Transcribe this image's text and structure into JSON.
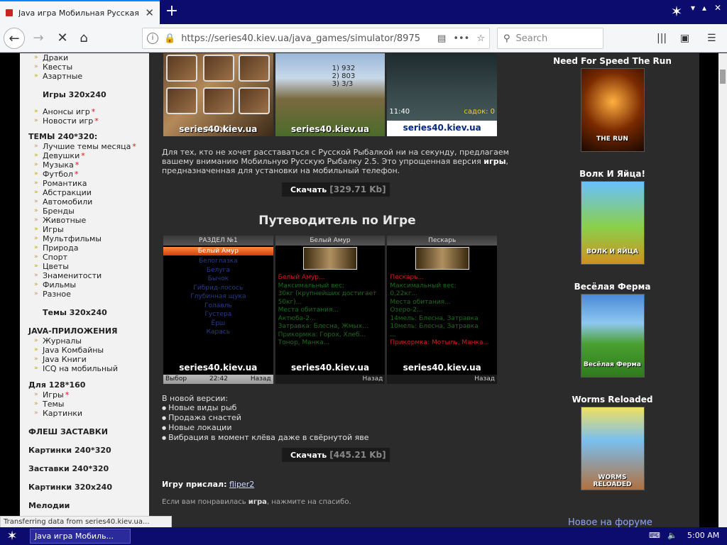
{
  "browser": {
    "tab_title": "Java игра Мобильная Русская Ры",
    "url": "https://series40.kiev.ua/java_games/simulator/8975",
    "search_placeholder": "Search"
  },
  "sidebar": {
    "top_items": [
      "Драки",
      "Квесты",
      "Азартные"
    ],
    "games_320": "Игры 320x240",
    "announce_items": [
      {
        "label": "Анонсы игр",
        "star": "*"
      },
      {
        "label": "Новости игр",
        "star": "*"
      }
    ],
    "themes_240_title": "ТЕМЫ 240*320:",
    "themes_240_items": [
      {
        "label": "Лучшие темы месяца",
        "star": "*"
      },
      {
        "label": "Девушки",
        "star": "*"
      },
      {
        "label": "Музыка",
        "star": "*"
      },
      {
        "label": "Футбол",
        "star": "*"
      },
      {
        "label": "Романтика",
        "star": ""
      },
      {
        "label": "Абстракции",
        "star": ""
      },
      {
        "label": "Автомобили",
        "star": ""
      },
      {
        "label": "Бренды",
        "star": ""
      },
      {
        "label": "Животные",
        "star": ""
      },
      {
        "label": "Игры",
        "star": ""
      },
      {
        "label": "Мультфильмы",
        "star": ""
      },
      {
        "label": "Природа",
        "star": ""
      },
      {
        "label": "Спорт",
        "star": ""
      },
      {
        "label": "Цветы",
        "star": ""
      },
      {
        "label": "Знаменитости",
        "star": ""
      },
      {
        "label": "Фильмы",
        "star": ""
      },
      {
        "label": "Разное",
        "star": ""
      }
    ],
    "themes_320": "Темы 320x240",
    "java_apps_title": "JAVA-ПРИЛОЖЕНИЯ",
    "java_apps_items": [
      "Журналы",
      "Java Комбайны",
      "Java Книги",
      "ICQ на мобильный"
    ],
    "for128_title": "Для 128*160",
    "for128_items": [
      {
        "label": "Игры",
        "star": "*"
      },
      {
        "label": "Темы",
        "star": ""
      },
      {
        "label": "Картинки",
        "star": ""
      }
    ],
    "bottom_sections": [
      "ФЛЕШ ЗАСТАВКИ",
      "Картинки 240*320",
      "Заставки 240*320",
      "Картинки 320x240",
      "Мелодии"
    ]
  },
  "main": {
    "watermark": "series40.kiev.ua",
    "shot1_hud_left": "водоем",
    "shot3_time": "11:40",
    "shot3_keep": "садок: 0",
    "shot2_values": [
      "1) 932",
      "2) 803",
      "3) 3/3"
    ],
    "desc_part1": "Для тех, кто не хочет расставаться с Русской Рыбалкой ни на секунду, предлагаем вашему вниманию Мобильную Русскую Рыбалку 2.5. Это упрощенная версия ",
    "desc_bold": "игры",
    "desc_part2": ", предназначенная для установки на мобильный телефон.",
    "download1_label": "Скачать",
    "download1_size": "[329.71 Kb]",
    "guide_title": "Путеводитель по Игре",
    "guide_shot1_title": "РАЗДЕЛ №1",
    "guide_shot1_selected": "Белый Амур",
    "guide_shot1_items": [
      "Белоглазка",
      "Белуга",
      "Бычок",
      "Гибрид-лосось",
      "Глубинная щука",
      "Голавль",
      "Густера",
      "Ёрш",
      "Карась"
    ],
    "guide_shot1_left": "Выбор",
    "guide_shot1_time": "22:42",
    "guide_shot1_right": "Назад",
    "guide_shot2_title": "Белый Амур",
    "guide_shot2_lines": [
      "Белый Амур...",
      "Максимальный вес:",
      "30кг (крупнейших достигает",
      "50кг)...",
      "Места обитания...",
      "Актюба-2...",
      "Затравка: Блесна, Жмых...",
      "Прикормка: Горох, Хлеб...",
      "Тонор, Манка..."
    ],
    "guide_shot2_right": "Назад",
    "guide_shot3_title": "Пескарь",
    "guide_shot3_lines": [
      "Пескарь...",
      "Максимальный вес:",
      "0,22кг...",
      "Места обитания...",
      "Озеро-2...",
      "14мель: Блесна, Затравка",
      "10мель: Блесна, Затравка",
      "...",
      "Прикормка: Мотыль, Манка..."
    ],
    "guide_shot3_right": "Назад",
    "new_version_title": "В новой версии:",
    "new_version_items": [
      "Новые виды рыб",
      "Продажа снастей",
      "Новые локации",
      "Вибрация в момент клёва даже в свёрнутой яве"
    ],
    "download2_label": "Скачать",
    "download2_size": "[445.21 Kb]",
    "sender_label": "Игру прислал:",
    "sender_name": "fliper2",
    "thanks_part1": "Если вам понравилась ",
    "thanks_bold": "игра",
    "thanks_part2": ", нажмите на спасибо."
  },
  "right": {
    "items": [
      {
        "title": "Need For Speed The Run",
        "cover_text": "THE RUN"
      },
      {
        "title": "Волк И Яйца!",
        "cover_text": "ВОЛК И ЯЙЦА"
      },
      {
        "title": "Весёлая Ферма",
        "cover_text": "Весёлая Ферма"
      },
      {
        "title": "Worms Reloaded",
        "cover_text": "WORMS RELOADED"
      }
    ],
    "forum_link": "Новое на форуме"
  },
  "status_text": "Transferring data from series40.kiev.ua...",
  "taskbar": {
    "task_label": "Java игра Мобиль...",
    "clock": "5:00 AM"
  }
}
